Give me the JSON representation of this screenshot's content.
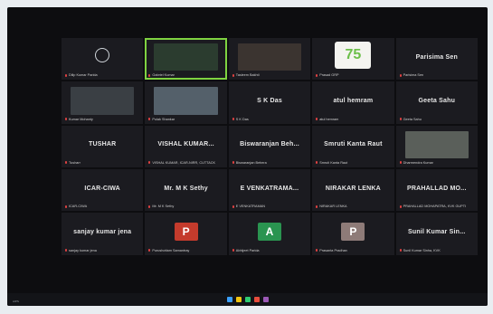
{
  "app": {
    "bottom_left_text": "AIPS"
  },
  "tiles": [
    {
      "name": "Dilip Kumar Parida",
      "big": "",
      "small": "Dilip Kumar Parida",
      "type": "ring"
    },
    {
      "name": "Gabriel Kumar",
      "big": "",
      "small": "Gabriel Kumar",
      "type": "video",
      "color": "#2b3c2f",
      "active": true
    },
    {
      "name": "Tasleem Bakhti",
      "big": "",
      "small": "Tasleem Bakhti",
      "type": "video",
      "color": "#3b3430"
    },
    {
      "name": "Prasad GRP",
      "big": "",
      "small": "Prasad GRP",
      "type": "logo"
    },
    {
      "name": "Parisima Sen",
      "big": "Parisima Sen",
      "small": "Parisima Sen",
      "type": "text"
    },
    {
      "name": "Kumar Mohanty",
      "big": "",
      "small": "Kumar Mohanty",
      "type": "video",
      "color": "#3a3f44"
    },
    {
      "name": "Pulak Shankar",
      "big": "",
      "small": "Pulak Shankar",
      "type": "video",
      "color": "#54606a"
    },
    {
      "name": "S K Das",
      "big": "S K Das",
      "small": "S K Das",
      "type": "text"
    },
    {
      "name": "atul hemram",
      "big": "atul hemram",
      "small": "atul hemram",
      "type": "text"
    },
    {
      "name": "Geeta Sahu",
      "big": "Geeta Sahu",
      "small": "Geeta Sahu",
      "type": "text"
    },
    {
      "name": "TUSHAR",
      "big": "TUSHAR",
      "small": "Tusharr",
      "type": "text"
    },
    {
      "name": "VISHAL KUMAR...",
      "big": "VISHAL KUMAR...",
      "small": "VISHAL KUMAR, ICAR-NIRR, CUTTACK",
      "type": "text"
    },
    {
      "name": "Biswaranjan Beh...",
      "big": "Biswaranjan Beh...",
      "small": "Biswaranjan Behera",
      "type": "text"
    },
    {
      "name": "Smruti Kanta Raut",
      "big": "Smruti Kanta Raut",
      "small": "Smruti Kanta Raut",
      "type": "text"
    },
    {
      "name": "Dharmendra Kumar",
      "big": "",
      "small": "Dharmendra Kumar",
      "type": "video",
      "color": "#5a5f5a"
    },
    {
      "name": "ICAR-CIWA",
      "big": "ICAR-CIWA",
      "small": "ICAR-CIWA",
      "type": "text"
    },
    {
      "name": "Mr. M K Sethy",
      "big": "Mr. M K Sethy",
      "small": "Mr. M K Sethy",
      "type": "text"
    },
    {
      "name": "E VENKATRAMA...",
      "big": "E VENKATRAMA...",
      "small": "E VENKATRAMAN",
      "type": "text"
    },
    {
      "name": "NIRAKAR LENKA",
      "big": "NIRAKAR LENKA",
      "small": "NIRAKAR LENKA",
      "type": "text"
    },
    {
      "name": "PRAHALLAD MO...",
      "big": "PRAHALLAD MO...",
      "small": "PRAHALLAD MOHAPATRA, KVK GUPTI",
      "type": "text"
    },
    {
      "name": "sanjay kumar jena",
      "big": "sanjay kumar jena",
      "small": "sanjay kumar jena",
      "type": "text"
    },
    {
      "name": "Purushottam Samantray",
      "big": "P",
      "small": "Purushottam Samantray",
      "type": "letter",
      "color": "#c43b2c"
    },
    {
      "name": "Abhijeet Parida",
      "big": "A",
      "small": "Abhijeet Parida",
      "type": "letter",
      "color": "#2a9450"
    },
    {
      "name": "Prasanta Pradhan",
      "big": "P",
      "small": "Prasanta Pradhan",
      "type": "letter",
      "color": "#8e7b78"
    },
    {
      "name": "Sunil Kumar Sin...",
      "big": "Sunil Kumar Sin...",
      "small": "Sunil Kumar Sinha, KVK",
      "type": "text"
    }
  ],
  "logo": {
    "text": "75",
    "color": "#6cbf4a"
  }
}
